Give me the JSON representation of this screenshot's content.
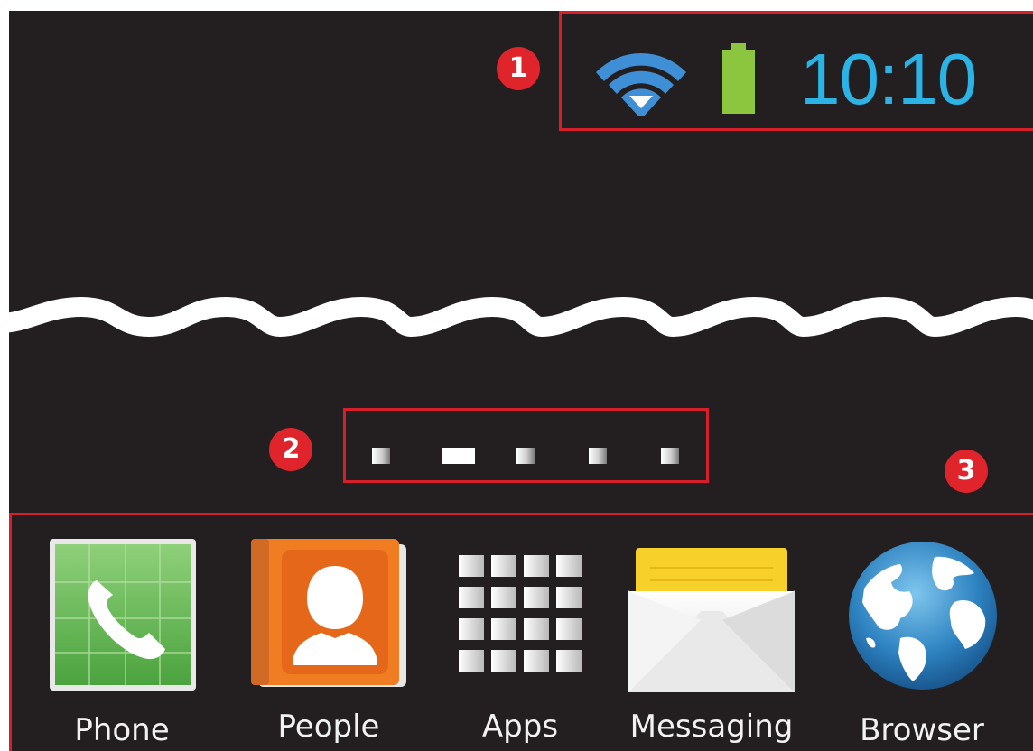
{
  "status_bar": {
    "time": "10:10",
    "wifi_icon": "wifi-icon",
    "battery_icon": "battery-icon",
    "time_color": "#2bb3e6",
    "wifi_color": "#3f8fd6",
    "battery_color": "#8cc63f"
  },
  "callouts": {
    "one": "1",
    "two": "2",
    "three": "3"
  },
  "page_indicator": {
    "page_count": 5,
    "active_page": 2
  },
  "dock": {
    "apps": [
      {
        "label": "Phone",
        "icon": "phone-icon"
      },
      {
        "label": "People",
        "icon": "people-icon"
      },
      {
        "label": "Apps",
        "icon": "apps-grid-icon"
      },
      {
        "label": "Messaging",
        "icon": "messaging-icon"
      },
      {
        "label": "Browser",
        "icon": "globe-icon"
      }
    ]
  },
  "colors": {
    "screen_background": "#231f20",
    "callout_red": "#e0242c"
  }
}
